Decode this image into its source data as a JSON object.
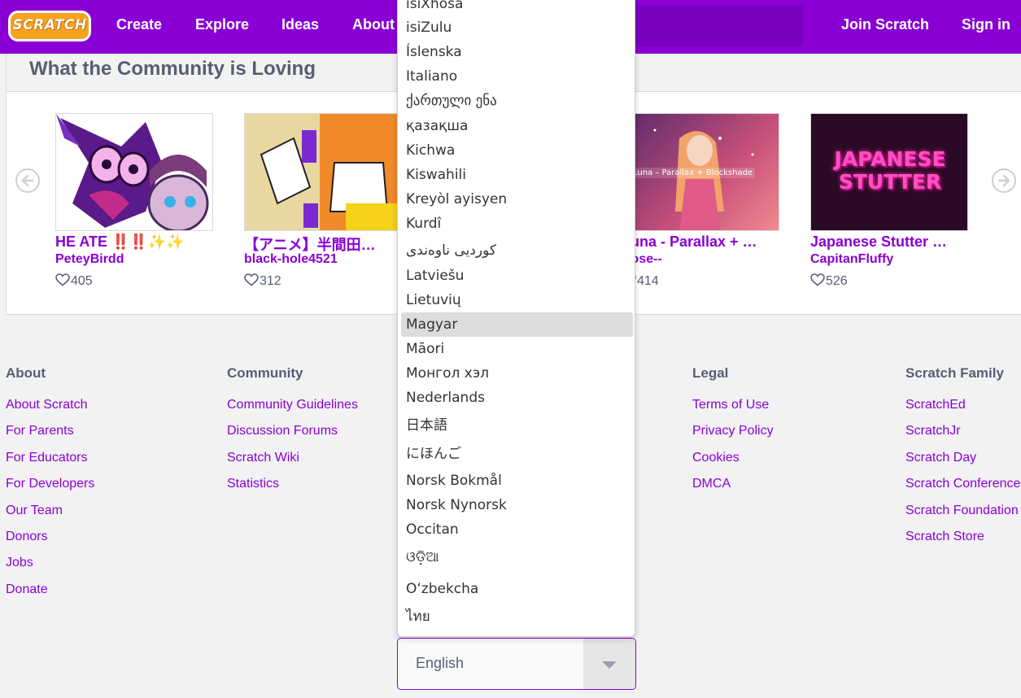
{
  "nav": {
    "logo_text": "SCRATCH",
    "links": [
      "Create",
      "Explore",
      "Ideas",
      "About"
    ],
    "join": "Join Scratch",
    "signin": "Sign in"
  },
  "community": {
    "title": "What the Community is Loving",
    "cards": [
      {
        "title": "HE ATE ‼️‼️✨✨",
        "author": "PeteyBirdd",
        "loves": "405"
      },
      {
        "title": "【アニメ】半間田…",
        "author": "black-hole4521",
        "loves": "312"
      },
      {
        "title": "Luna - Parallax + …",
        "author": "Rose--",
        "loves": "414",
        "thumb_caption": "Luna – Parallax + Blockshade"
      },
      {
        "title": "Japanese Stutter …",
        "author": "CapitanFluffy",
        "loves": "526",
        "thumb_text": "JAPANESE STUTTER"
      }
    ]
  },
  "footer": {
    "columns": [
      {
        "heading": "About",
        "links": [
          "About Scratch",
          "For Parents",
          "For Educators",
          "For Developers",
          "Our Team",
          "Donors",
          "Jobs",
          "Donate"
        ]
      },
      {
        "heading": "Community",
        "links": [
          "Community Guidelines",
          "Discussion Forums",
          "Scratch Wiki",
          "Statistics"
        ]
      },
      {
        "heading": "Legal",
        "links": [
          "Terms of Use",
          "Privacy Policy",
          "Cookies",
          "DMCA"
        ]
      },
      {
        "heading": "Scratch Family",
        "links": [
          "ScratchEd",
          "ScratchJr",
          "Scratch Day",
          "Scratch Conference",
          "Scratch Foundation",
          "Scratch Store"
        ]
      }
    ]
  },
  "language": {
    "selected": "English",
    "options": [
      "isiXhosa",
      "isiZulu",
      "Íslenska",
      "Italiano",
      "ქართული ენა",
      "қазақша",
      "Kichwa",
      "Kiswahili",
      "Kreyòl ayisyen",
      "Kurdî",
      "کوردیی ناوەندی",
      "Latviešu",
      "Lietuvių",
      "Magyar",
      "Māori",
      "Монгол хэл",
      "Nederlands",
      "日本語",
      "にほんご",
      "Norsk Bokmål",
      "Norsk Nynorsk",
      "Occitan",
      "ଓଡ଼ିଆ",
      "Oʻzbekcha",
      "ไทย"
    ],
    "highlighted": "Magyar"
  },
  "colors": {
    "brand": "#8a00d4",
    "logo": "#f9a21e"
  }
}
